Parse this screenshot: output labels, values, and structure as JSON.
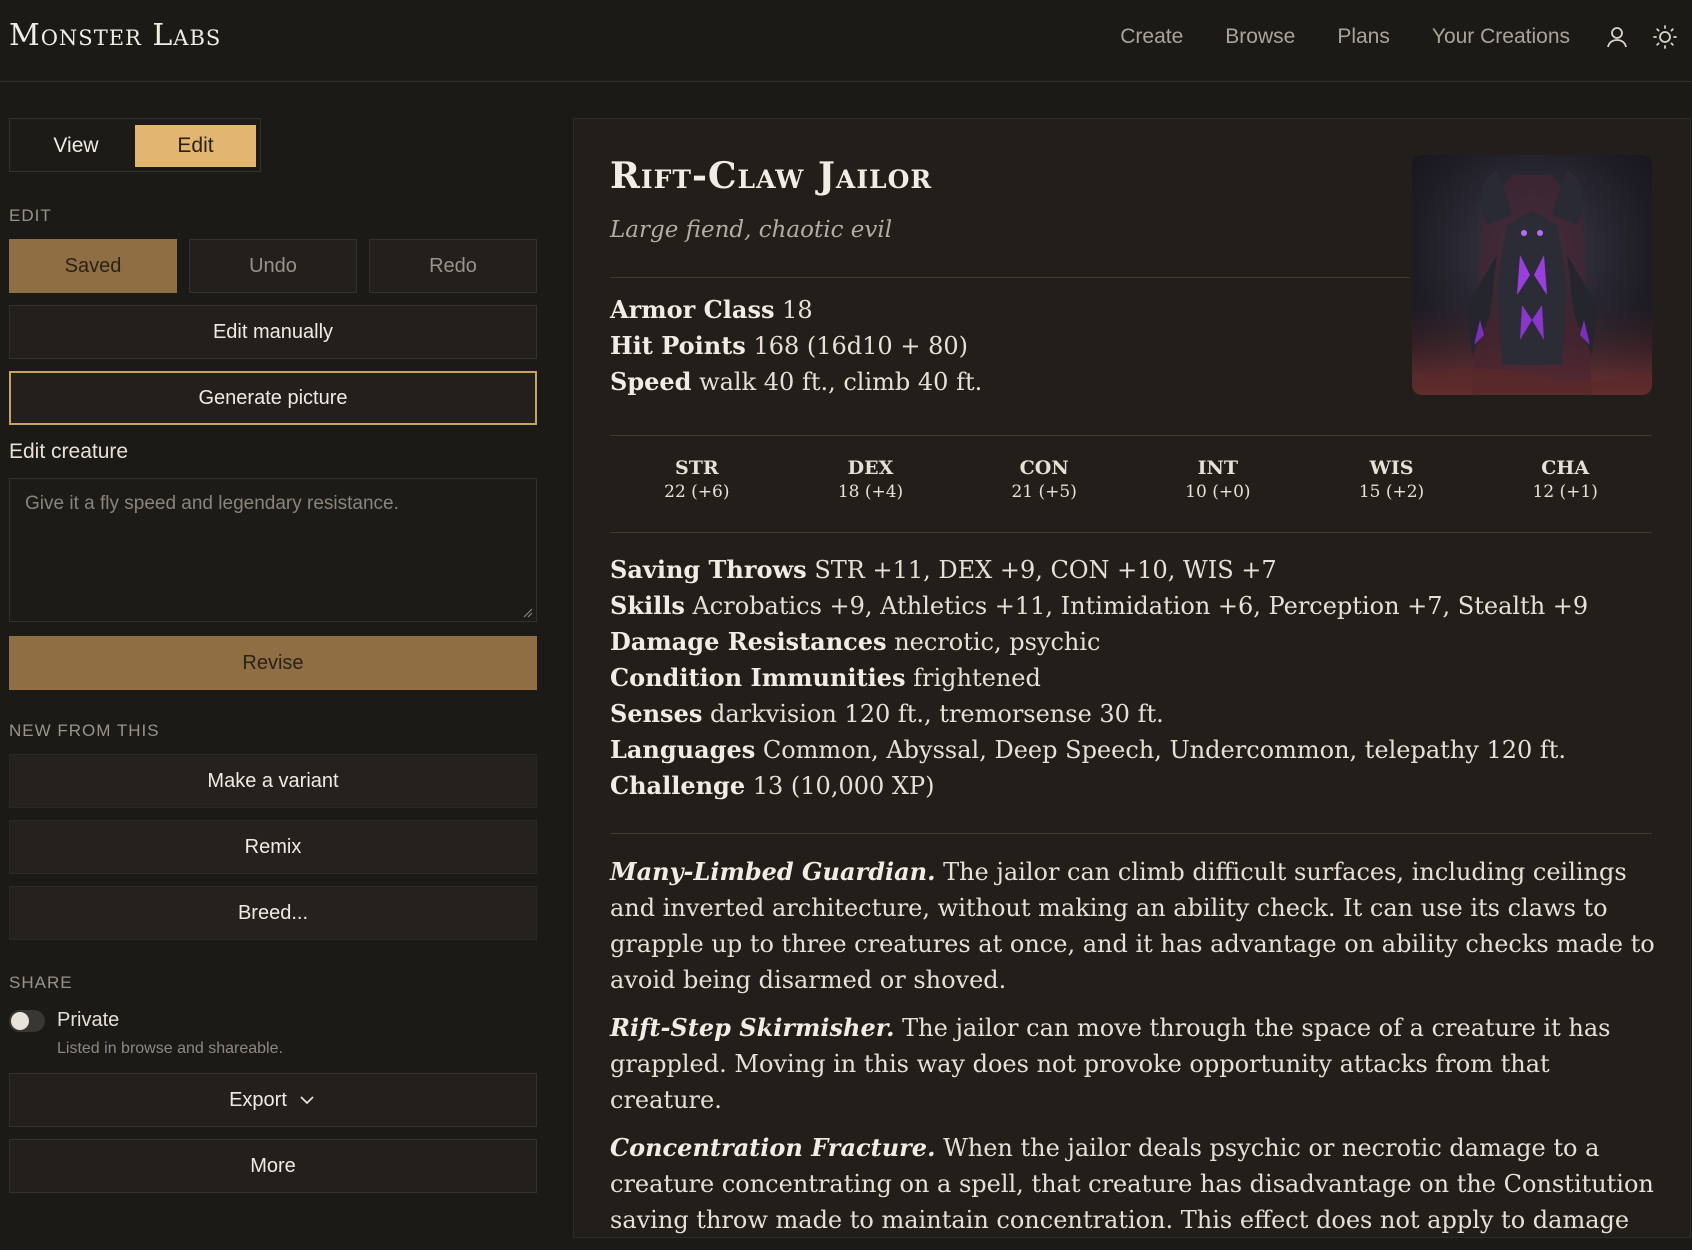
{
  "header": {
    "brand": "Monster Labs",
    "nav": [
      "Create",
      "Browse",
      "Plans",
      "Your Creations"
    ],
    "icons": [
      "user-icon",
      "sun-icon"
    ]
  },
  "sidebar": {
    "mode": {
      "view": "View",
      "edit": "Edit",
      "active": "Edit"
    },
    "edit_section": "EDIT",
    "saved": "Saved",
    "undo": "Undo",
    "redo": "Redo",
    "edit_manually": "Edit manually",
    "generate_picture": "Generate picture",
    "edit_creature_label": "Edit creature",
    "edit_creature_placeholder": "Give it a fly speed and legendary resistance.",
    "revise": "Revise",
    "new_section": "NEW FROM THIS",
    "make_variant": "Make a variant",
    "remix": "Remix",
    "breed": "Breed...",
    "share_section": "SHARE",
    "private_label": "Private",
    "private_sub": "Listed in browse and shareable.",
    "private_on": false,
    "export": "Export",
    "more": "More"
  },
  "monster": {
    "name": "Rift-Claw Jailor",
    "type": "Large fiend, chaotic evil",
    "armor_class_label": "Armor Class",
    "armor_class": "18",
    "hit_points_label": "Hit Points",
    "hit_points": "168 (16d10 + 80)",
    "speed_label": "Speed",
    "speed": "walk 40 ft., climb 40 ft.",
    "abilities": [
      {
        "name": "STR",
        "value": "22 (+6)"
      },
      {
        "name": "DEX",
        "value": "18 (+4)"
      },
      {
        "name": "CON",
        "value": "21 (+5)"
      },
      {
        "name": "INT",
        "value": "10 (+0)"
      },
      {
        "name": "WIS",
        "value": "15 (+2)"
      },
      {
        "name": "CHA",
        "value": "12 (+1)"
      }
    ],
    "saving_throws_label": "Saving Throws",
    "saving_throws": "STR +11, DEX +9, CON +10, WIS +7",
    "skills_label": "Skills",
    "skills": "Acrobatics +9, Athletics +11, Intimidation +6, Perception +7, Stealth +9",
    "damage_resistances_label": "Damage Resistances",
    "damage_resistances": "necrotic, psychic",
    "condition_immunities_label": "Condition Immunities",
    "condition_immunities": "frightened",
    "senses_label": "Senses",
    "senses": "darkvision 120 ft., tremorsense 30 ft.",
    "languages_label": "Languages",
    "languages": "Common, Abyssal, Deep Speech, Undercommon, telepathy 120 ft.",
    "challenge_label": "Challenge",
    "challenge": "13 (10,000 XP)",
    "traits": [
      {
        "name": "Many-Limbed Guardian.",
        "text": "The jailor can climb difficult surfaces, including ceilings and inverted architecture, without making an ability check. It can use its claws to grapple up to three creatures at once, and it has advantage on ability checks made to avoid being disarmed or shoved."
      },
      {
        "name": "Rift-Step Skirmisher.",
        "text": "The jailor can move through the space of a creature it has grappled. Moving in this way does not provoke opportunity attacks from that creature."
      },
      {
        "name": "Concentration Fracture.",
        "text": "When the jailor deals psychic or necrotic damage to a creature concentrating on a spell, that creature has disadvantage on the Constitution saving throw made to maintain concentration. This effect does not apply to damage"
      }
    ]
  },
  "colors": {
    "accent": "#e3b66f",
    "accent_dark": "#8e6e42",
    "background": "#1c1a17",
    "card": "#221f1b"
  }
}
